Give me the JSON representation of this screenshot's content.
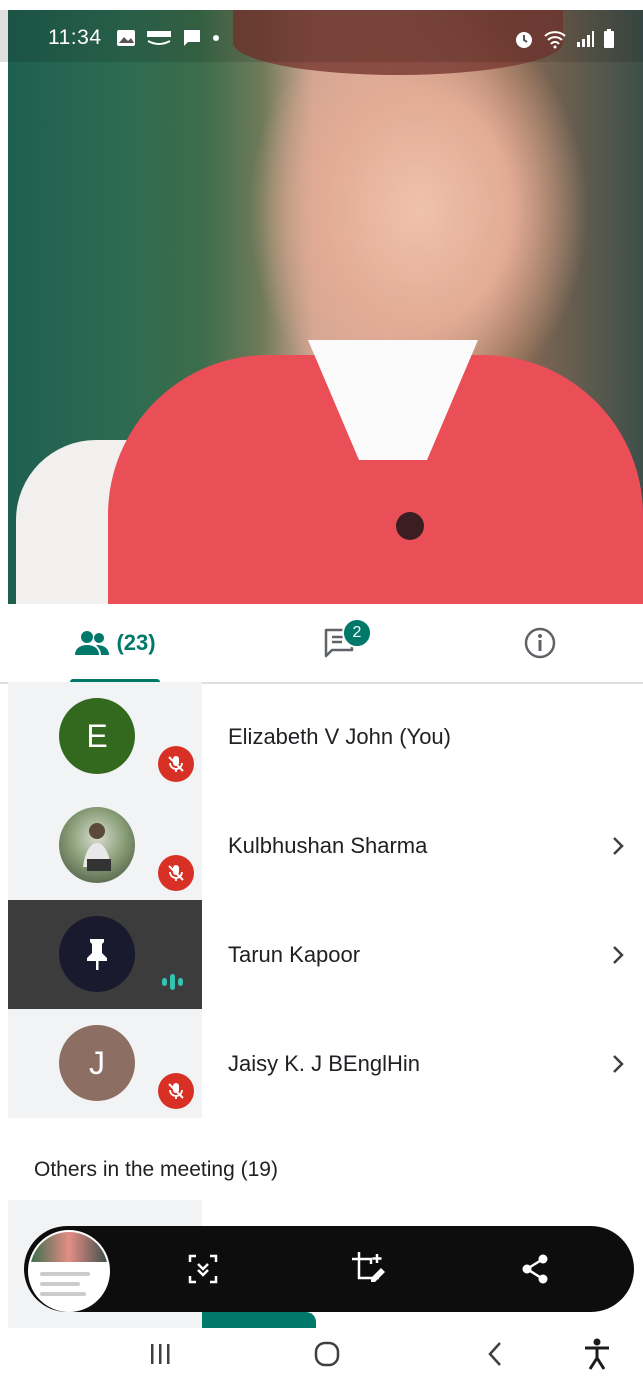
{
  "status_bar": {
    "time": "11:34",
    "left_icons": [
      "gallery-icon",
      "amazon-icon",
      "message-icon",
      "dot-icon"
    ],
    "right_icons": [
      "alarm-icon",
      "wifi-icon",
      "signal-icon",
      "battery-icon"
    ]
  },
  "tabs": {
    "people": {
      "icon": "people-icon",
      "count_label": "(23)"
    },
    "chat": {
      "icon": "chat-icon",
      "badge": "2"
    },
    "info": {
      "icon": "info-icon"
    }
  },
  "participants": [
    {
      "initial": "E",
      "name": "Elizabeth V John (You)",
      "avatar_color": "#33691e",
      "muted": true,
      "chevron": false
    },
    {
      "initial": "",
      "name": "Kulbhushan Sharma",
      "avatar_color": "#6b7b6a",
      "muted": true,
      "chevron": true
    },
    {
      "initial": "",
      "name": "Tarun Kapoor",
      "avatar_color": "#1a1a2e",
      "muted": false,
      "speaking": true,
      "pinned": true,
      "chevron": true
    },
    {
      "initial": "J",
      "name": "Jaisy K. J BEnglHin",
      "avatar_color": "#8d6e63",
      "muted": true,
      "chevron": true
    }
  ],
  "others_heading": "Others in the meeting (19)",
  "capture_toolbar": {
    "buttons": [
      "scroll-capture-icon",
      "crop-edit-icon",
      "share-icon"
    ]
  },
  "nav_bar": {
    "buttons": [
      "recents-icon",
      "home-icon",
      "back-icon",
      "accessibility-icon"
    ]
  },
  "colors": {
    "accent": "#00796b",
    "muted_red": "#d93025",
    "speaking": "#34c3b0"
  }
}
